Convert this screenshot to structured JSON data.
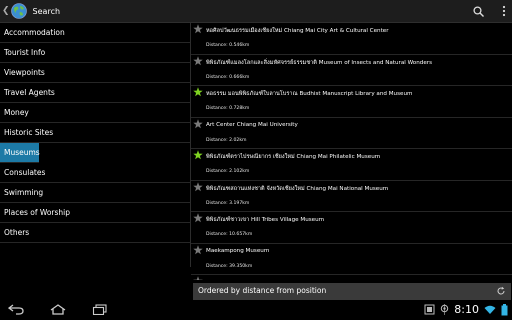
{
  "app": {
    "title": "Search"
  },
  "sidebar": {
    "items": [
      {
        "label": "Accommodation",
        "selected": false
      },
      {
        "label": "Tourist Info",
        "selected": false
      },
      {
        "label": "Viewpoints",
        "selected": false
      },
      {
        "label": "Travel Agents",
        "selected": false
      },
      {
        "label": "Money",
        "selected": false
      },
      {
        "label": "Historic Sites",
        "selected": false
      },
      {
        "label": "Museums",
        "selected": true
      },
      {
        "label": "Consulates",
        "selected": false
      },
      {
        "label": "Swimming",
        "selected": false
      },
      {
        "label": "Places of Worship",
        "selected": false
      },
      {
        "label": "Others",
        "selected": false
      }
    ]
  },
  "results": [
    {
      "title": "หอศิลปวัฒนธรรมเมืองเชียงใหม่ Chiang Mai City Art & Cultural Center",
      "distance": "Distance: 0.546km",
      "favorite": false
    },
    {
      "title": "พิพิธภัณฑ์แมลงโลกและสิ่งมหัศจรรย์ธรรมชาติ Museum of Insects and Natural Wonders",
      "distance": "Distance: 0.666km",
      "favorite": false
    },
    {
      "title": "หอธรรม มอนพิพิธภัณฑ์ใบลานโบราณ Budhist Manuscript Library and Museum",
      "distance": "Distance: 0.728km",
      "favorite": true
    },
    {
      "title": "Art Center Chiang Mai University",
      "distance": "Distance: 2.02km",
      "favorite": false
    },
    {
      "title": "พิพิธภัณฑ์ตราไปรษณียากร เชียงใหม่ Chiang Mai Philatelic Museum",
      "distance": "Distance: 2.102km",
      "favorite": true
    },
    {
      "title": "พิพิธภัณฑสถานแห่งชาติ จังหวัดเชียงใหม่ Chiang Mai National Museum",
      "distance": "Distance: 3.197km",
      "favorite": false
    },
    {
      "title": "พิพิธภัณฑ์ชาวเขา Hill Tribes Village Museum",
      "distance": "Distance: 10.657km",
      "favorite": false
    },
    {
      "title": "Maekampong Museum",
      "distance": "Distance: 39.350km",
      "favorite": false
    }
  ],
  "footer": {
    "sort_label": "Ordered by distance from position"
  },
  "statusbar": {
    "time": "8:10"
  },
  "colors": {
    "selected": "#1d7aa6",
    "star_fav": "#7fd321",
    "star": "#7a7a7a"
  },
  "icons": [
    "back-chevron-icon",
    "app-globe-icon",
    "search-icon",
    "overflow-menu-icon",
    "star-icon",
    "refresh-icon",
    "back-nav-icon",
    "home-nav-icon",
    "recents-nav-icon",
    "screenshot-icon",
    "location-icon",
    "wifi-icon",
    "battery-icon"
  ]
}
